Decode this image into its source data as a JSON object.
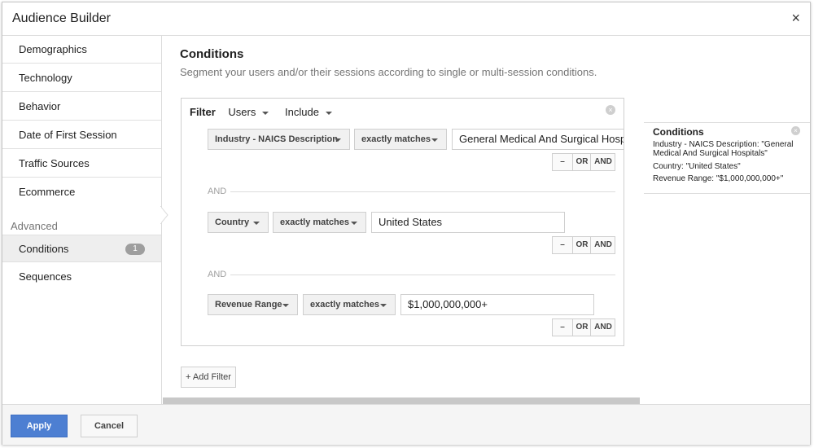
{
  "dialog": {
    "title": "Audience Builder",
    "close_icon": "×"
  },
  "sidebar": {
    "items": [
      {
        "label": "Demographics"
      },
      {
        "label": "Technology"
      },
      {
        "label": "Behavior"
      },
      {
        "label": "Date of First Session"
      },
      {
        "label": "Traffic Sources"
      },
      {
        "label": "Ecommerce"
      }
    ],
    "section_label": "Advanced",
    "advanced_items": [
      {
        "label": "Conditions",
        "badge": "1",
        "active": true
      },
      {
        "label": "Sequences"
      }
    ]
  },
  "main": {
    "heading": "Conditions",
    "subheading": "Segment your users and/or their sessions according to single or multi-session conditions.",
    "filter": {
      "label": "Filter",
      "scope": "Users",
      "mode": "Include",
      "remove_icon": "×",
      "and_label": "AND",
      "conditions": [
        {
          "dimension": "Industry - NAICS Description",
          "operator": "exactly matches",
          "value": "General Medical And Surgical Hospitals"
        },
        {
          "dimension": "Country",
          "operator": "exactly matches",
          "value": "United States"
        },
        {
          "dimension": "Revenue Range",
          "operator": "exactly matches",
          "value": "$1,000,000,000+"
        }
      ],
      "btn_minus": "–",
      "btn_or": "OR",
      "btn_and": "AND"
    },
    "add_filter": "+ Add Filter"
  },
  "summary": {
    "title": "Conditions",
    "remove_icon": "×",
    "lines": [
      "Industry - NAICS Description: \"General Medical And Surgical Hospitals\"",
      "Country: \"United States\"",
      "Revenue Range: \"$1,000,000,000+\""
    ]
  },
  "footer": {
    "apply": "Apply",
    "cancel": "Cancel"
  },
  "colors": {
    "accent": "#4d7fd2",
    "badge": "#9e9e9e"
  }
}
